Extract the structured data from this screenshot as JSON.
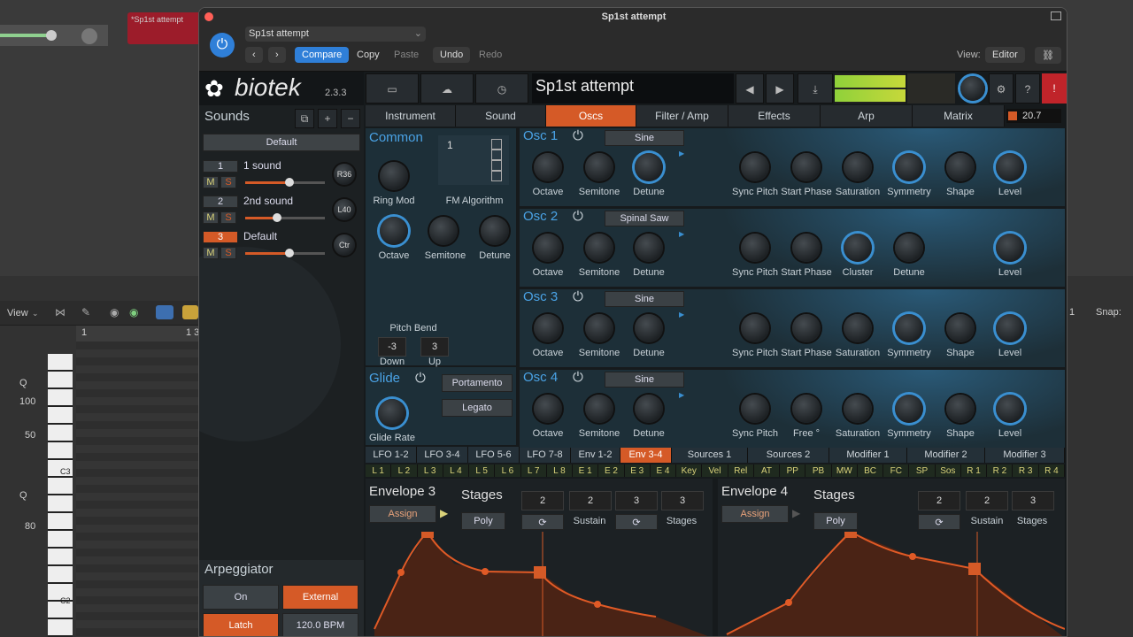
{
  "daw": {
    "region_label": "*Sp1st attempt",
    "view_label": "View",
    "q1": "Q",
    "q2": "Q",
    "v100": "100",
    "v50": "50",
    "v80": "80",
    "note_c3": "C3",
    "note_c2": "C2",
    "ruler_1": "1",
    "ruler_13": "1 3",
    "snap": "Snap:",
    "track_num": "1"
  },
  "window": {
    "title": "Sp1st attempt",
    "preset": "Sp1st attempt",
    "compare": "Compare",
    "copy": "Copy",
    "paste": "Paste",
    "undo": "Undo",
    "redo": "Redo",
    "view_label": "View:",
    "view_value": "Editor"
  },
  "plugin": {
    "logo": "biotek",
    "version": "2.3.3",
    "preset_name": "Sp1st attempt",
    "level_value": "20.7",
    "sounds_title": "Sounds",
    "default_label": "Default",
    "sounds": [
      {
        "num": "1",
        "name": "1 sound",
        "pan": "R36"
      },
      {
        "num": "2",
        "name": "2nd sound",
        "pan": "L40"
      },
      {
        "num": "3",
        "name": "Default",
        "pan": "Ctr"
      }
    ],
    "mute": "M",
    "solo": "S",
    "tabs": [
      "Instrument",
      "Sound",
      "Oscs",
      "Filter / Amp",
      "Effects",
      "Arp",
      "Matrix"
    ],
    "common": {
      "title": "Common",
      "ring_mod": "Ring Mod",
      "fm_algorithm": "FM Algorithm",
      "fm_value": "1",
      "octave": "Octave",
      "semitone": "Semitone",
      "detune": "Detune",
      "pitch_bend": "Pitch Bend",
      "down_val": "-3",
      "up_val": "3",
      "down": "Down",
      "up": "Up"
    },
    "glide": {
      "title": "Glide",
      "portamento": "Portamento",
      "legato": "Legato",
      "rate": "Glide Rate"
    },
    "oscs": [
      {
        "title": "Osc 1",
        "wave": "Sine",
        "k4": "Sync Pitch",
        "k5": "Start Phase",
        "k6": "Saturation",
        "k7": "Symmetry",
        "k8": "Shape",
        "k9": "Level"
      },
      {
        "title": "Osc 2",
        "wave": "Spinal Saw",
        "k4": "Sync Pitch",
        "k5": "Start Phase",
        "k6": "Cluster",
        "k7": "Detune",
        "k8": "",
        "k9": "Level"
      },
      {
        "title": "Osc 3",
        "wave": "Sine",
        "k4": "Sync Pitch",
        "k5": "Start Phase",
        "k6": "Saturation",
        "k7": "Symmetry",
        "k8": "Shape",
        "k9": "Level"
      },
      {
        "title": "Osc 4",
        "wave": "Sine",
        "k4": "Sync Pitch",
        "k5": "Free °",
        "k6": "Saturation",
        "k7": "Symmetry",
        "k8": "Shape",
        "k9": "Level"
      }
    ],
    "osc_common": {
      "octave": "Octave",
      "semitone": "Semitone",
      "detune": "Detune"
    },
    "mod_tabs": [
      "LFO 1-2",
      "LFO 3-4",
      "LFO 5-6",
      "LFO 7-8",
      "Env 1-2",
      "Env 3-4",
      "Sources 1",
      "Sources 2",
      "Modifier 1",
      "Modifier 2",
      "Modifier 3"
    ],
    "chips": [
      "L 1",
      "L 2",
      "L 3",
      "L 4",
      "L 5",
      "L 6",
      "L 7",
      "L 8",
      "E 1",
      "E 2",
      "E 3",
      "E 4",
      "Key",
      "Vel",
      "Rel",
      "AT",
      "PP",
      "PB",
      "MW",
      "BC",
      "FC",
      "SP",
      "Sos",
      "R 1",
      "R 2",
      "R 3",
      "R 4"
    ],
    "env3": {
      "title": "Envelope 3",
      "assign": "Assign",
      "stages": "Stages",
      "poly": "Poly",
      "v1": "2",
      "v2": "2",
      "v3": "3",
      "v4": "3",
      "sustain": "Sustain",
      "stages2": "Stages"
    },
    "env4": {
      "title": "Envelope 4",
      "assign": "Assign",
      "stages": "Stages",
      "poly": "Poly",
      "v1": "2",
      "v2": "2",
      "v3": "3",
      "sustain": "Sustain",
      "stages2": "Stages"
    },
    "arp": {
      "title": "Arpeggiator",
      "on": "On",
      "external": "External",
      "latch": "Latch",
      "bpm": "120.0 BPM"
    }
  }
}
